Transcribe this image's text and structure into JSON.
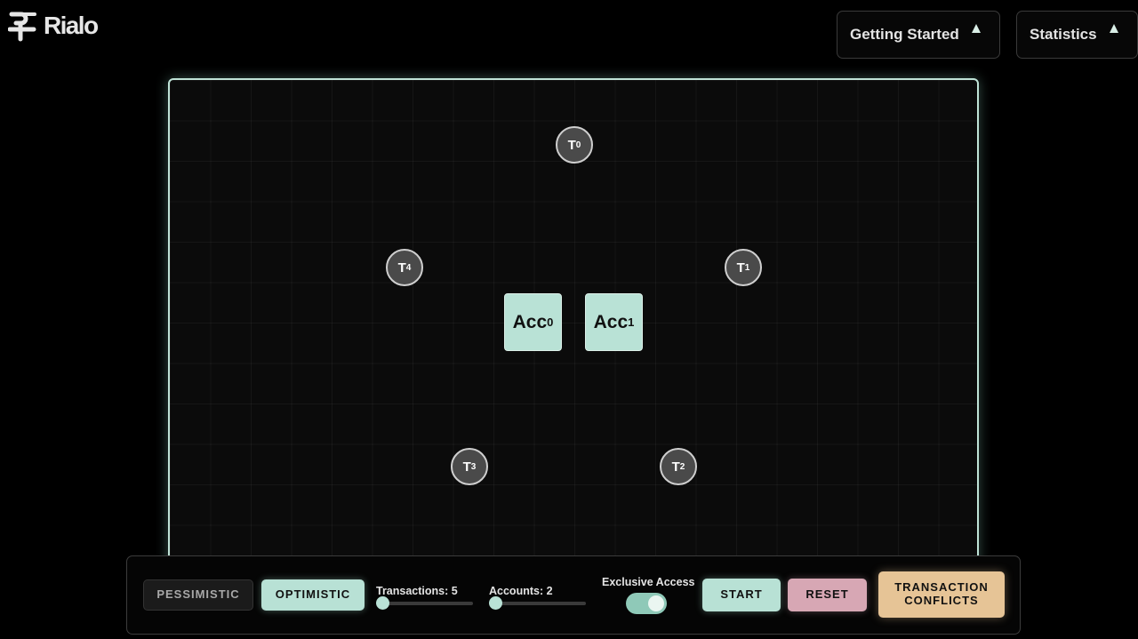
{
  "brand": {
    "name": "Rialo"
  },
  "nav": {
    "getting_started": "Getting Started",
    "statistics": "Statistics"
  },
  "canvas": {
    "transactions": [
      {
        "base": "T",
        "index": "0"
      },
      {
        "base": "T",
        "index": "1"
      },
      {
        "base": "T",
        "index": "2"
      },
      {
        "base": "T",
        "index": "3"
      },
      {
        "base": "T",
        "index": "4"
      }
    ],
    "accounts": [
      {
        "base": "Acc",
        "index": "0"
      },
      {
        "base": "Acc",
        "index": "1"
      }
    ]
  },
  "controls": {
    "pessimistic": "PESSIMISTIC",
    "optimistic": "OPTIMISTIC",
    "transactions_label": "Transactions: 5",
    "transactions_value": 5,
    "accounts_label": "Accounts: 2",
    "accounts_value": 2,
    "exclusive_access_label": "Exclusive Access",
    "exclusive_access_on": true,
    "start": "START",
    "reset": "RESET",
    "conflicts_line1": "TRANSACTION",
    "conflicts_line2": "CONFLICTS"
  },
  "colors": {
    "accent": "#b8e1d5",
    "reset": "#d7a7b4",
    "conflicts": "#e6c496"
  },
  "icons": {
    "logo": "rialo-logo-icon",
    "dropdown": "chevron-up-icon"
  }
}
